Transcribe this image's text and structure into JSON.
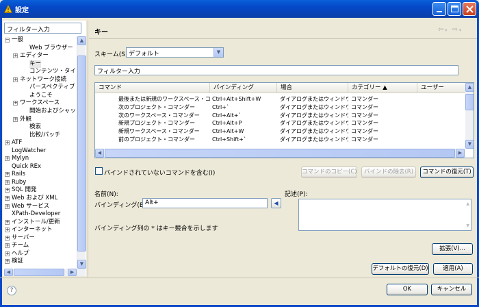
{
  "window": {
    "title": "設定"
  },
  "left": {
    "filter_placeholder": "フィルター入力",
    "tree": [
      {
        "label": "一般",
        "exp": "⊟",
        "level": 0
      },
      {
        "label": "Web ブラウザー",
        "exp": "",
        "level": 2
      },
      {
        "label": "エディター",
        "exp": "⊞",
        "level": 1
      },
      {
        "label": "キー",
        "exp": "",
        "level": 2
      },
      {
        "label": "コンテンツ・タイプ",
        "exp": "",
        "level": 2
      },
      {
        "label": "ネットワーク接続",
        "exp": "⊞",
        "level": 1
      },
      {
        "label": "パースペクティブ",
        "exp": "",
        "level": 2
      },
      {
        "label": "ようこそ",
        "exp": "",
        "level": 2
      },
      {
        "label": "ワークスペース",
        "exp": "⊞",
        "level": 1
      },
      {
        "label": "開始およびシャット",
        "exp": "",
        "level": 2
      },
      {
        "label": "外観",
        "exp": "⊞",
        "level": 1
      },
      {
        "label": "検索",
        "exp": "",
        "level": 2
      },
      {
        "label": "比較/パッチ",
        "exp": "",
        "level": 2
      },
      {
        "label": "ATF",
        "exp": "⊞",
        "level": 0
      },
      {
        "label": "LogWatcher",
        "exp": "",
        "level": 0
      },
      {
        "label": "Mylyn",
        "exp": "⊞",
        "level": 0
      },
      {
        "label": "Quick REx",
        "exp": "",
        "level": 0
      },
      {
        "label": "Rails",
        "exp": "⊞",
        "level": 0
      },
      {
        "label": "Ruby",
        "exp": "⊞",
        "level": 0
      },
      {
        "label": "SQL 開発",
        "exp": "⊞",
        "level": 0
      },
      {
        "label": "Web および XML",
        "exp": "⊞",
        "level": 0
      },
      {
        "label": "Web サービス",
        "exp": "⊞",
        "level": 0
      },
      {
        "label": "XPath-Developer",
        "exp": "",
        "level": 0
      },
      {
        "label": "インストール/更新",
        "exp": "⊞",
        "level": 0
      },
      {
        "label": "インターネット",
        "exp": "⊞",
        "level": 0
      },
      {
        "label": "サーバー",
        "exp": "⊞",
        "level": 0
      },
      {
        "label": "チーム",
        "exp": "⊞",
        "level": 0
      },
      {
        "label": "ヘルプ",
        "exp": "⊞",
        "level": 0
      },
      {
        "label": "検証",
        "exp": "⊞",
        "level": 0
      }
    ]
  },
  "main": {
    "title": "キー",
    "scheme_label": "スキーム(S):",
    "scheme_value": "デフォルト",
    "filter_value": "フィルター入力",
    "columns": [
      "コマンド",
      "バインディング",
      "場合",
      "カテゴリー ▲",
      "ユーザー"
    ],
    "rows": [
      [
        "最後または新規のワークスペース・コマ",
        "Ctrl+Alt+Shift+W",
        "ダイアログまたはウィンドウ",
        "コマンダー",
        ""
      ],
      [
        "次のプロジェクト・コマンダー",
        "Ctrl+`",
        "ダイアログまたはウィンドウ",
        "コマンダー",
        ""
      ],
      [
        "次のワークスペース・コマンダー",
        "Ctrl+Alt+`",
        "ダイアログまたはウィンドウ",
        "コマンダー",
        ""
      ],
      [
        "新規プロジェクト・コマンダー",
        "Ctrl+Alt+P",
        "ダイアログまたはウィンドウ",
        "コマンダー",
        ""
      ],
      [
        "新規ワークスペース・コマンダー",
        "Ctrl+Alt+W",
        "ダイアログまたはウィンドウ",
        "コマンダー",
        ""
      ],
      [
        "前のプロジェクト・コマンダー",
        "Ctrl+Shift+`",
        "ダイアログまたはウィンドウ",
        "コマンダー",
        ""
      ]
    ],
    "include_unbound_label": "バインドされていないコマンドを含む(I)",
    "copy_command": "コマンドのコピー(C)",
    "remove_binding": "バインドの除去(R)",
    "restore_command": "コマンドの復元(T)",
    "name_label": "名前(N):",
    "binding_label": "バインディング(B):",
    "binding_value": "Alt+",
    "conflict_note": "バインディング列の * はキー競合を示します",
    "description_label": "記述(P):",
    "extend_button": "拡張(V)...",
    "restore_defaults": "デフォルトの復元(D)",
    "apply": "適用(A)"
  },
  "footer": {
    "ok": "OK",
    "cancel": "キャンセル"
  }
}
